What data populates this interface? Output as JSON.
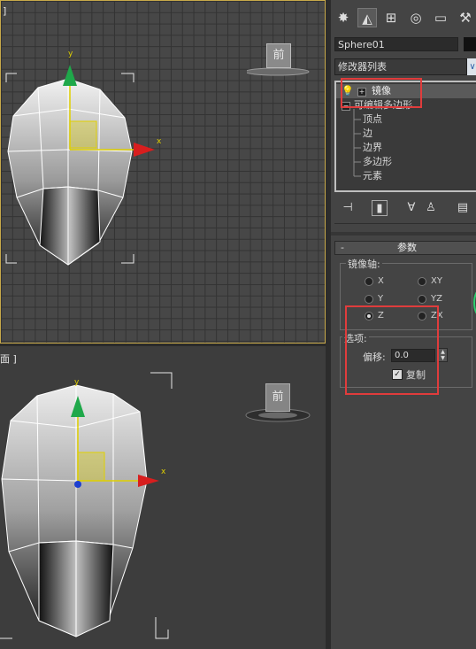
{
  "viewport_top": {
    "corner_label": "]",
    "viewcube_label": "前",
    "axis_x_label": "x",
    "axis_y_label": "y"
  },
  "viewport_bottom": {
    "corner_label": "面 ]",
    "viewcube_label": "前",
    "axis_x_label": "x",
    "axis_y_label": "y"
  },
  "command_panel": {
    "tabs": [
      "create-icon",
      "modify-icon",
      "hierarchy-icon",
      "motion-icon",
      "display-icon",
      "utilities-icon"
    ],
    "object_name": "Sphere01",
    "modifier_list_label": "修改器列表",
    "stack": {
      "top_item": "镜像",
      "base_item": "可编辑多边形",
      "sub_items": [
        "顶点",
        "边",
        "边界",
        "多边形",
        "元素"
      ]
    },
    "stack_tools": [
      "pin-stack-icon",
      "show-end-result-icon",
      "make-unique-icon",
      "remove-modifier-icon",
      "configure-sets-icon"
    ],
    "rollout": {
      "title_prefix": "-",
      "title": "参数",
      "mirror_axis_label": "镜像轴:",
      "axes": [
        {
          "label": "X",
          "selected": false
        },
        {
          "label": "XY",
          "selected": false
        },
        {
          "label": "Y",
          "selected": false
        },
        {
          "label": "YZ",
          "selected": false
        },
        {
          "label": "Z",
          "selected": true
        },
        {
          "label": "ZX",
          "selected": false
        }
      ],
      "options_label": "选项:",
      "offset_label": "偏移:",
      "offset_value": "0.0",
      "copy_label": "复制",
      "copy_checked": true
    }
  },
  "colors": {
    "highlight_box": "#e03c3c",
    "viewport_active_border": "#c8a94a",
    "axis_x": "#d81e1e",
    "axis_y": "#1fa84a",
    "gizmo": "#e0d000"
  }
}
